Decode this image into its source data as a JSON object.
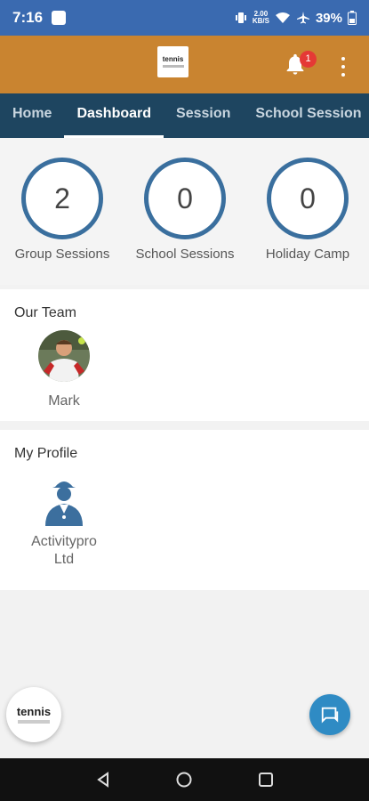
{
  "status": {
    "time": "7:16",
    "speed": "2.00\nKB/S",
    "battery": "39%"
  },
  "header": {
    "logo_text": "tennis",
    "notification_count": "1"
  },
  "tabs": [
    {
      "label": "Home"
    },
    {
      "label": "Dashboard"
    },
    {
      "label": "Session"
    },
    {
      "label": "School Session"
    }
  ],
  "stats": [
    {
      "value": "2",
      "label": "Group Sessions"
    },
    {
      "value": "0",
      "label": "School Sessions"
    },
    {
      "value": "0",
      "label": "Holiday Camp"
    }
  ],
  "team": {
    "title": "Our Team",
    "members": [
      {
        "name": "Mark"
      }
    ]
  },
  "profile": {
    "title": "My Profile",
    "name": "Activitypro\nLtd"
  },
  "footer": {
    "logo_text": "tennis"
  },
  "colors": {
    "accent": "#c98430",
    "tabbar": "#1e4560",
    "ring": "#3a6f9e",
    "fab": "#2f8bc4"
  }
}
